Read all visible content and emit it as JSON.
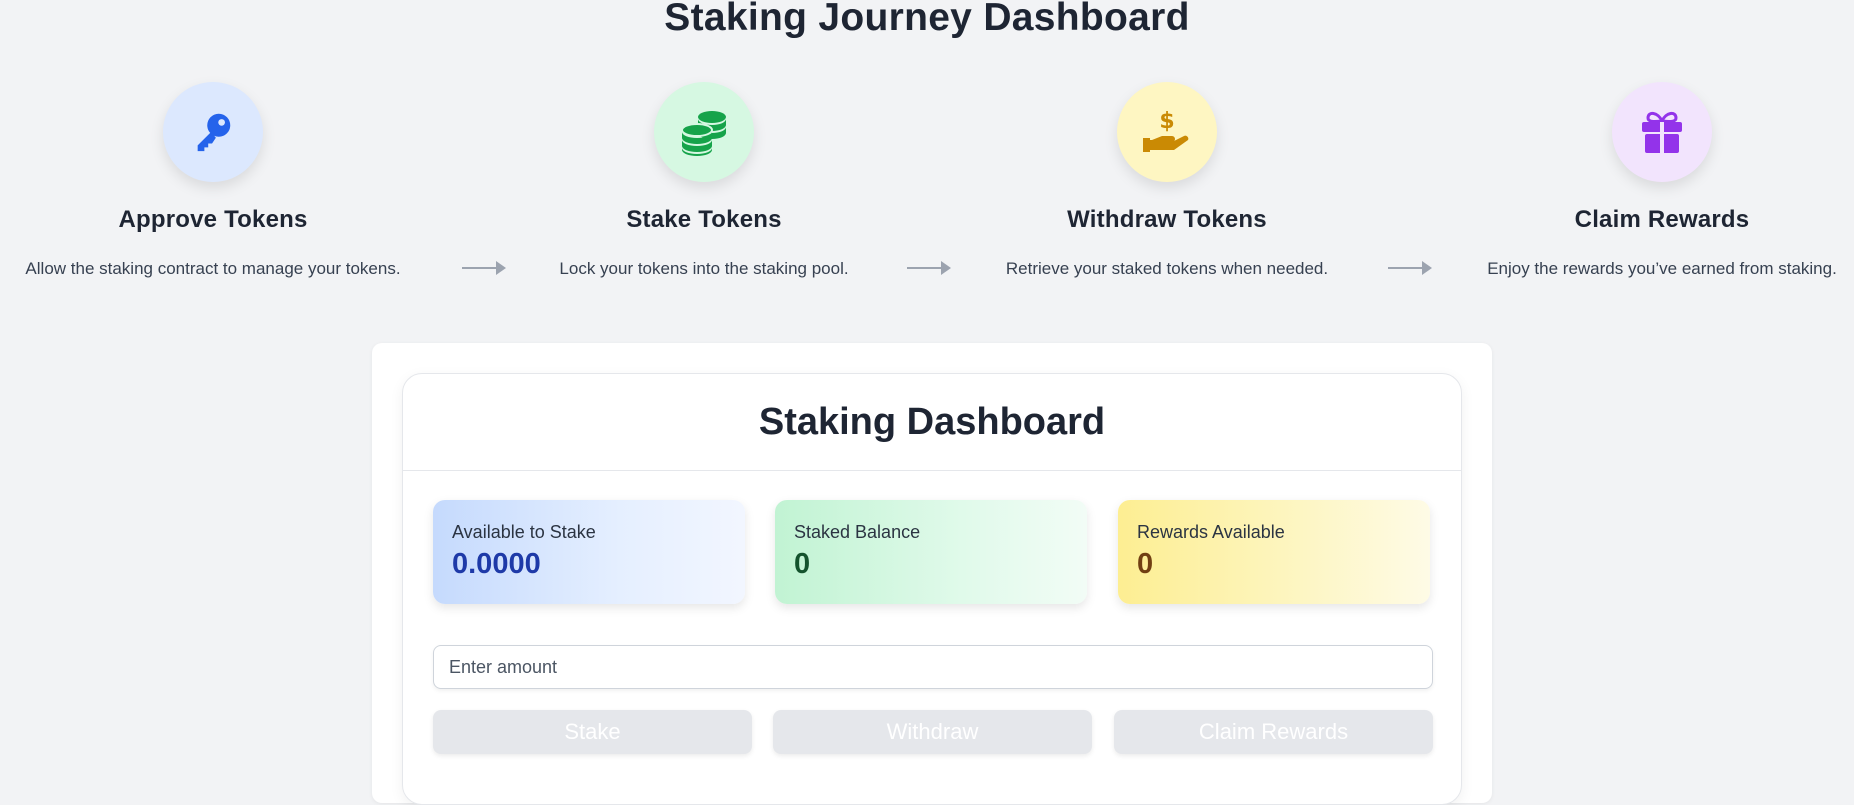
{
  "page": {
    "title": "Staking Journey Dashboard"
  },
  "journey": {
    "steps": [
      {
        "title": "Approve Tokens",
        "description": "Allow the staking contract to manage your tokens.",
        "icon": "key-icon",
        "bg": "#dce8fe",
        "color": "#2563eb"
      },
      {
        "title": "Stake Tokens",
        "description": "Lock your tokens into the staking pool.",
        "icon": "coins-icon",
        "bg": "#d6f8e2",
        "color": "#16a34a"
      },
      {
        "title": "Withdraw Tokens",
        "description": "Retrieve your staked tokens when needed.",
        "icon": "hand-dollar-icon",
        "bg": "#fef6c2",
        "color": "#ca8a04"
      },
      {
        "title": "Claim Rewards",
        "description": "Enjoy the rewards you’ve earned from staking.",
        "icon": "gift-icon",
        "bg": "#f2e4fd",
        "color": "#9333ea"
      }
    ]
  },
  "dashboard": {
    "title": "Staking Dashboard",
    "stats": [
      {
        "label": "Available to Stake",
        "value": "0.0000"
      },
      {
        "label": "Staked Balance",
        "value": "0"
      },
      {
        "label": "Rewards Available",
        "value": "0"
      }
    ],
    "amount_input": {
      "placeholder": "Enter amount",
      "value": ""
    },
    "buttons": {
      "stake": "Stake",
      "withdraw": "Withdraw",
      "claim": "Claim Rewards"
    }
  }
}
